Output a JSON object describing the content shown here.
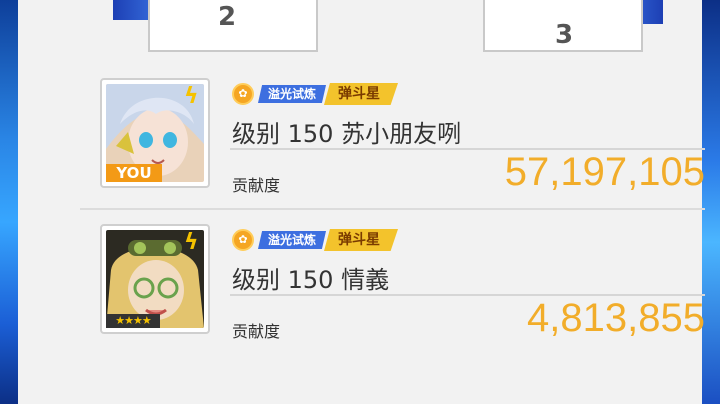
{
  "podium": {
    "second": "2",
    "third": "3"
  },
  "entries": [
    {
      "tag_trial": "溢光试炼",
      "tag_rank": "弹斗星",
      "name": "级别 150 苏小朋友咧",
      "contrib_label": "贡献度",
      "score": "57,197,105",
      "you_label": "YOU",
      "stars": "",
      "avatar_icon": "anime-character-white-hair"
    },
    {
      "tag_trial": "溢光试炼",
      "tag_rank": "弹斗星",
      "name": "级别 150 情義",
      "contrib_label": "贡献度",
      "score": "4,813,855",
      "you_label": "",
      "stars": "★★★★",
      "avatar_icon": "anime-character-blonde-goggles"
    }
  ],
  "colors": {
    "accent_gold": "#f2ad2a",
    "trial_blue": "#3d6fe0",
    "rank_yellow": "#f3c32c",
    "you_orange": "#f39a16"
  }
}
